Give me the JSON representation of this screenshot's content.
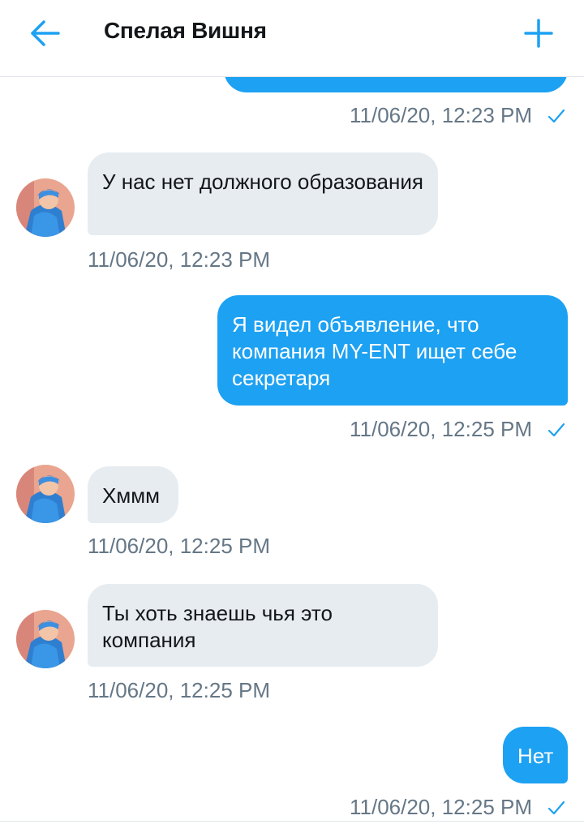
{
  "header": {
    "title": "Спелая Вишня",
    "back_icon": "arrow-left-icon",
    "add_icon": "plus-icon"
  },
  "colors": {
    "accent": "#1da1f2",
    "incoming_bubble": "#e6ecf0",
    "timestamp": "#657786"
  },
  "messages": [
    {
      "direction": "outgoing",
      "text": "",
      "timestamp": "11/06/20, 12:23 PM",
      "read_icon": "check-icon"
    },
    {
      "direction": "incoming",
      "text": "У нас нет должного образования",
      "timestamp": "11/06/20, 12:23 PM"
    },
    {
      "direction": "outgoing",
      "text": "Я видел объявление, что компания MY-ENT ищет себе секретаря",
      "timestamp": "11/06/20, 12:25 PM",
      "read_icon": "check-icon"
    },
    {
      "direction": "incoming",
      "text": "Хммм",
      "timestamp": "11/06/20, 12:25 PM"
    },
    {
      "direction": "incoming",
      "text": "Ты хоть знаешь чья это компания",
      "timestamp": "11/06/20, 12:25 PM"
    },
    {
      "direction": "outgoing",
      "text": "Нет",
      "timestamp": "11/06/20, 12:25 PM",
      "read_icon": "check-icon"
    }
  ]
}
